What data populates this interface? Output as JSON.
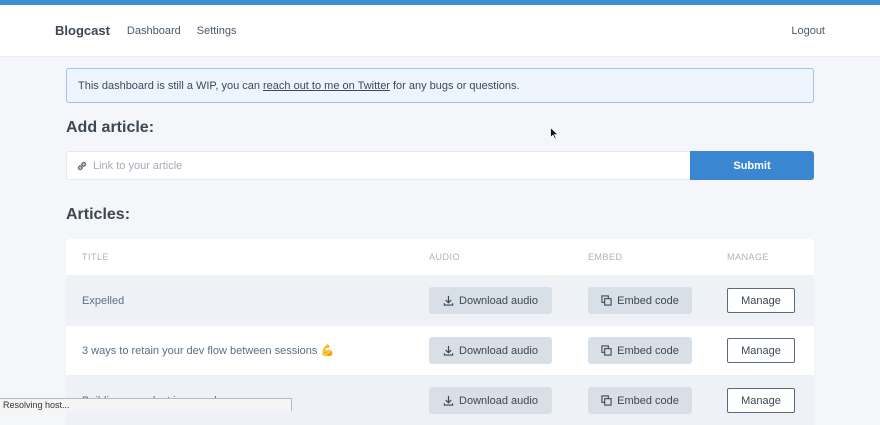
{
  "nav": {
    "brand": "Blogcast",
    "links": [
      "Dashboard",
      "Settings"
    ],
    "logout": "Logout"
  },
  "notice": {
    "before": "This dashboard is still a WIP, you can",
    "link": "reach out to me on Twitter",
    "after": "for any bugs or questions."
  },
  "add_article": {
    "heading": "Add article:",
    "placeholder": "Link to your article",
    "value": "",
    "submit": "Submit"
  },
  "articles": {
    "heading": "Articles:",
    "columns": [
      "TITLE",
      "AUDIO",
      "EMBED",
      "MANAGE"
    ],
    "rows": [
      {
        "title": "Expelled",
        "download": "Download audio",
        "embed": "Embed code",
        "manage": "Manage"
      },
      {
        "title": "3 ways to retain your dev flow between sessions 💪",
        "download": "Download audio",
        "embed": "Embed code",
        "manage": "Manage"
      },
      {
        "title": "Building a product in a week",
        "download": "Download audio",
        "embed": "Embed code",
        "manage": "Manage"
      }
    ]
  },
  "status_bar": "Resolving host...",
  "colors": {
    "accent": "#3a86d0",
    "top_bar": "#3d8fd6",
    "notice_border": "#9fc4e8"
  }
}
